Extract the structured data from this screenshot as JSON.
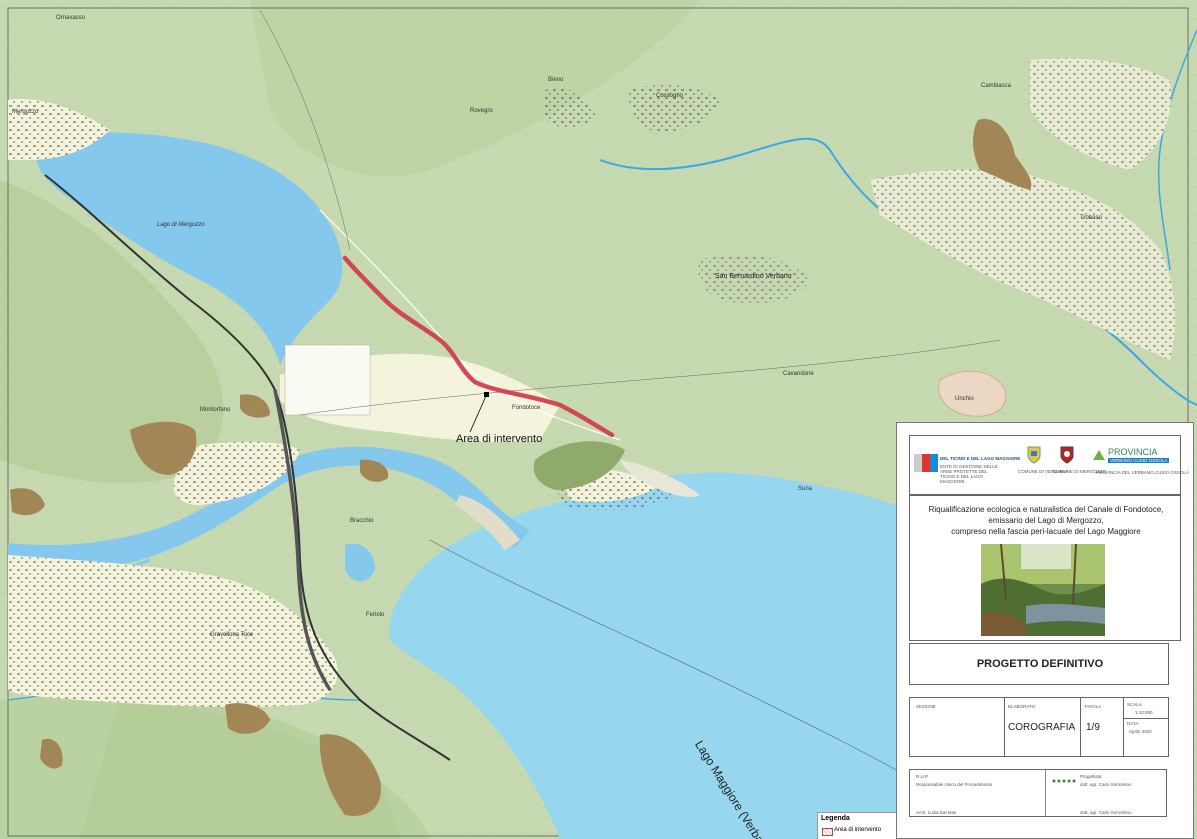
{
  "map": {
    "labels": {
      "mergozzo": "Mergozzo",
      "lago_mergozzo": "Lago di Mergozzo",
      "cossogno": "Cossogno",
      "cambiasca": "Cambiasca",
      "san_bernardino": "San Bernardino Verbano",
      "fondotoce": "Fondotoce",
      "lago_maggiore": "Lago  Maggiore (Verbano)",
      "area_intervento": "Area di intervento",
      "montorfano": "Montorfano",
      "bieno": "Bieno",
      "cavandone": "Cavandone",
      "unchio": "Unchio",
      "trobaso": "Trobaso",
      "suna": "Suna",
      "feriolo": "Feriolo",
      "gravellona": "Gravellona Toce",
      "ornavasso": "Ornavasso",
      "rovegro": "Rovegro",
      "bracchio": "Bracchio"
    },
    "colors": {
      "land": "#c6d9b0",
      "land_dark": "#a8c48c",
      "lake_mergozzo": "#84c8ee",
      "lake_maggiore": "#96d7ef",
      "river": "#3ba7e6",
      "urban": "#f4f4dc",
      "quarry": "#a38656",
      "intervention": "#d03a4a"
    }
  },
  "legend": {
    "title": "Legenda",
    "item": "Area di intervento"
  },
  "title_block": {
    "logos": {
      "ente": "ENTE DI GESTIONE DELLE AREE PROTETTE DEL TICINO E DEL LAGO MAGGIORE",
      "comune_verbania": "COMUNE DI VERBANIA",
      "comune_mergozzo": "COMUNE DI MERGOZZO",
      "provincia": "PROVINCIA",
      "provincia_sub": "VERBANO CUSIO OSSOLA",
      "provincia_caption": "PROVINCIA DEL VERBANO CUSIO OSSOLA"
    },
    "project_title_lines": [
      "Riqualificazione ecologica e naturalistica del Canale di Fondotoce,",
      "emissario del Lago di Mergozzo,",
      "compreso nella fascia peri-lacuale del Lago Maggiore"
    ],
    "stage": "PROGETTO DEFINITIVO",
    "table": {
      "sezione_label": "SEZIONE",
      "elaborato_label": "ELABORATO",
      "elaborato": "COROGRAFIA",
      "tavola_label": "TAVOLA",
      "tavola": "1/9",
      "scala_label": "SCALA",
      "scala": "1:10.000",
      "data_label": "DATA",
      "data": "Aprile 2022"
    },
    "credits": {
      "rup_label": "R.U.P.",
      "rup_role": "Responsabile Unico del Procedimento",
      "rup_name": "Arch. Luisa Dal Mas",
      "progettista_label": "Progettista",
      "progettista_name": "dott. agr. Carlo Sorrentino",
      "progettista_sign": "dott. agr. Carlo Sorrentino"
    }
  }
}
